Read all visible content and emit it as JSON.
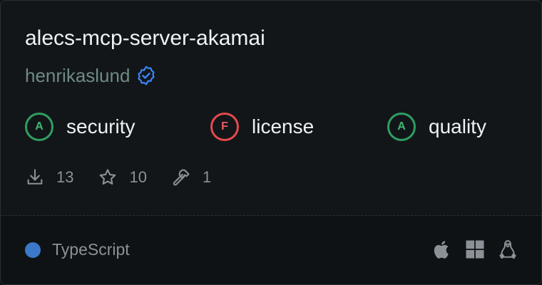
{
  "server": {
    "name": "alecs-mcp-server-akamai",
    "author": "henrikaslund",
    "verified_icon": "verified-badge-icon"
  },
  "scores": [
    {
      "grade": "A",
      "label": "security",
      "color": "#3fb872"
    },
    {
      "grade": "F",
      "label": "license",
      "color": "#ef5a5e"
    },
    {
      "grade": "A",
      "label": "quality",
      "color": "#3fb872"
    }
  ],
  "stats": {
    "downloads": "13",
    "stars": "10",
    "tools": "1"
  },
  "footer": {
    "language": "TypeScript",
    "language_color": "#3b78c9",
    "platforms": [
      "apple-icon",
      "windows-icon",
      "linux-icon"
    ]
  },
  "colors": {
    "accent_blue": "#3b82f6",
    "grade_good": "#2f9e62",
    "grade_bad": "#e44a4e"
  }
}
